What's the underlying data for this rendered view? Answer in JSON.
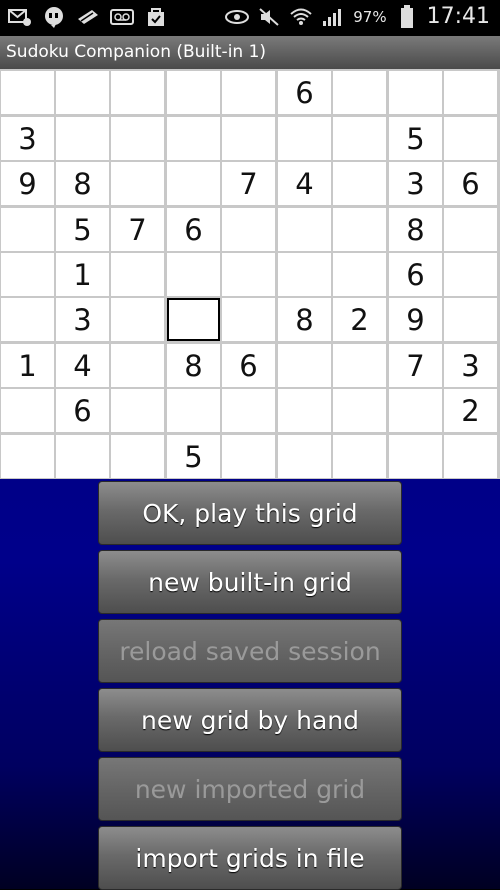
{
  "status_bar": {
    "battery_percent": "97%",
    "time": "17:41",
    "left_icons": [
      "mail-icon",
      "chat-bubble-icon",
      "ticket-icon",
      "voicemail-icon",
      "bag-check-icon"
    ],
    "right_icons": [
      "eye-icon",
      "mute-icon",
      "wifi-icon",
      "signal-icon",
      "battery-icon"
    ]
  },
  "app": {
    "title": "Sudoku Companion (Built-in 1)"
  },
  "grid": {
    "selected": [
      5,
      3
    ],
    "rows": [
      [
        "",
        "",
        "",
        "",
        "",
        "6",
        "",
        "",
        ""
      ],
      [
        "3",
        "",
        "",
        "",
        "",
        "",
        "",
        "5",
        ""
      ],
      [
        "9",
        "8",
        "",
        "",
        "7",
        "4",
        "",
        "3",
        "6"
      ],
      [
        "",
        "5",
        "7",
        "6",
        "",
        "",
        "",
        "8",
        ""
      ],
      [
        "",
        "1",
        "",
        "",
        "",
        "",
        "",
        "6",
        ""
      ],
      [
        "",
        "3",
        "",
        "",
        "",
        "8",
        "2",
        "9",
        ""
      ],
      [
        "1",
        "4",
        "",
        "8",
        "6",
        "",
        "",
        "7",
        "3"
      ],
      [
        "",
        "6",
        "",
        "",
        "",
        "",
        "",
        "",
        "2"
      ],
      [
        "",
        "",
        "",
        "5",
        "",
        "",
        "",
        "",
        ""
      ]
    ]
  },
  "buttons": [
    {
      "label": "OK, play this grid",
      "enabled": true
    },
    {
      "label": "new built-in grid",
      "enabled": true
    },
    {
      "label": "reload saved session",
      "enabled": false
    },
    {
      "label": "new grid by hand",
      "enabled": true
    },
    {
      "label": "new imported grid",
      "enabled": false
    },
    {
      "label": "import grids in file",
      "enabled": true
    }
  ]
}
